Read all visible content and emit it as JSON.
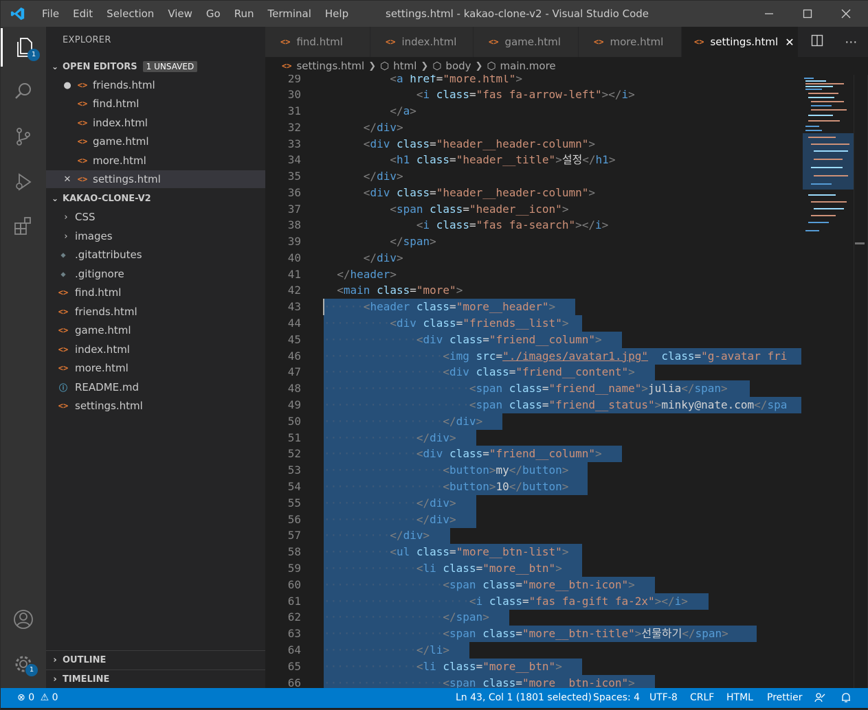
{
  "window": {
    "title": "settings.html - kakao-clone-v2 - Visual Studio Code",
    "menu": [
      "File",
      "Edit",
      "Selection",
      "View",
      "Go",
      "Run",
      "Terminal",
      "Help"
    ]
  },
  "activity_bar": {
    "explorer_badge": "1",
    "settings_badge": "1"
  },
  "sidebar": {
    "title": "EXPLORER",
    "open_editors_label": "OPEN EDITORS",
    "unsaved_badge": "1 UNSAVED",
    "open_editors": [
      "friends.html",
      "find.html",
      "index.html",
      "game.html",
      "more.html",
      "settings.html"
    ],
    "project_label": "KAKAO-CLONE-V2",
    "folders": [
      "CSS",
      "images"
    ],
    "files": [
      ".gitattributes",
      ".gitignore",
      "find.html",
      "friends.html",
      "game.html",
      "index.html",
      "more.html",
      "README.md",
      "settings.html"
    ],
    "outline_label": "OUTLINE",
    "timeline_label": "TIMELINE"
  },
  "tabs": [
    "find.html",
    "index.html",
    "game.html",
    "more.html",
    "settings.html"
  ],
  "breadcrumb": [
    "settings.html",
    "html",
    "body",
    "main.more"
  ],
  "editor": {
    "line_numbers": [
      "29",
      "30",
      "31",
      "32",
      "33",
      "34",
      "35",
      "36",
      "37",
      "38",
      "39",
      "40",
      "41",
      "42",
      "43",
      "44",
      "45",
      "46",
      "47",
      "48",
      "49",
      "50",
      "51",
      "52",
      "53",
      "54",
      "55",
      "56",
      "57",
      "58",
      "59",
      "60",
      "61",
      "62",
      "63",
      "64",
      "65",
      "66"
    ]
  },
  "status_bar": {
    "errors": "0",
    "warnings": "0",
    "position": "Ln 43, Col 1 (1801 selected)",
    "spaces": "Spaces: 4",
    "encoding": "UTF-8",
    "eol": "CRLF",
    "language": "HTML",
    "formatter": "Prettier"
  }
}
